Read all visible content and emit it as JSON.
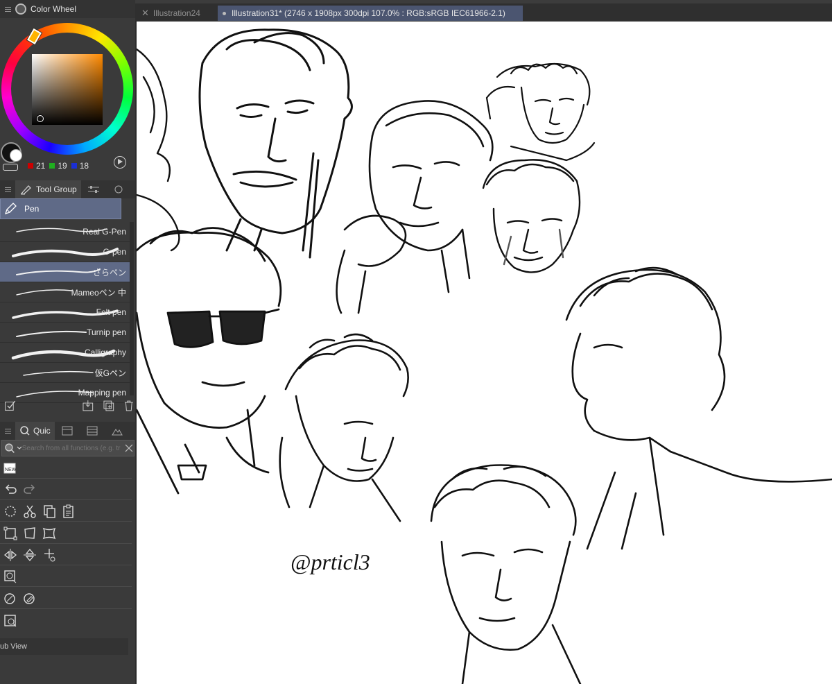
{
  "color_wheel": {
    "title": "Color Wheel",
    "r": "21",
    "g": "19",
    "b": "18",
    "main_color": "#121212",
    "sub_color": "#ffffff",
    "hue_color": "#ff8a00"
  },
  "tool_panel": {
    "tab_label": "Tool Group",
    "sub_tool": "Pen",
    "brushes": [
      {
        "label": "Real G-Pen"
      },
      {
        "label": "G-pen"
      },
      {
        "label": "さらペン"
      },
      {
        "label": "Mameoペン 中"
      },
      {
        "label": "Felt pen"
      },
      {
        "label": "Turnip pen"
      },
      {
        "label": "Calligraphy"
      },
      {
        "label": "仮Gペン"
      },
      {
        "label": "Mapping pen"
      }
    ],
    "selected_index": 2,
    "accent": "#5f6a87"
  },
  "quick_access": {
    "tab_label": "Quic",
    "search_placeholder": "Search from all functions (e.g. tr",
    "new_badge": "NEW",
    "sub_view_label": "ub View"
  },
  "tabs": [
    {
      "label": "Illustration24"
    },
    {
      "label": "Illustration31* (2746 x 1908px 300dpi 107.0% : RGB:sRGB IEC61966-2.1)"
    }
  ],
  "canvas": {
    "signature": "@prticl3"
  }
}
